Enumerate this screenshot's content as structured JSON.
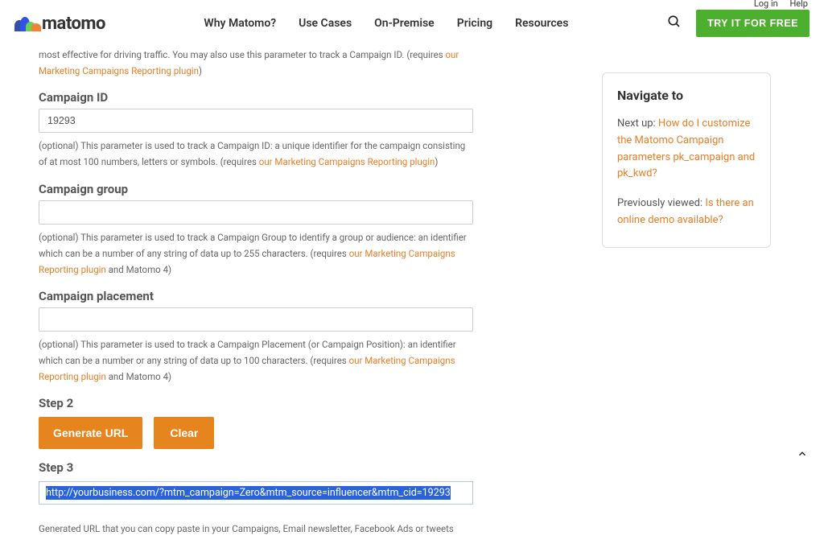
{
  "utilbar": {
    "login": "Log in",
    "help": "Help"
  },
  "brand": {
    "name": "matomo"
  },
  "nav": {
    "why": "Why Matomo?",
    "use_cases": "Use Cases",
    "on_premise": "On-Premise",
    "pricing": "Pricing",
    "resources": "Resources"
  },
  "cta_label": "TRY IT FOR FREE",
  "form": {
    "content_help_prefix": "most effective for driving traffic. You may also use this parameter to track a Campaign ID. (requires ",
    "content_help_link": "our Marketing Campaigns Reporting plugin",
    "content_help_suffix": ")",
    "campaign_id_label": "Campaign ID",
    "campaign_id_value": "19293",
    "campaign_id_help_prefix": "(optional) This parameter is used to track a Campaign ID: a unique identifier for the campaign consisting of at most 100 numbers, letters or symbols. (requires ",
    "campaign_id_help_link": "our Marketing Campaigns Reporting plugin",
    "campaign_id_help_suffix": ")",
    "campaign_group_label": "Campaign group",
    "campaign_group_value": "",
    "campaign_group_help_prefix": "(optional) This parameter is used to track a Campaign Group to identify a group or audience: an identifier which can be a number of any string of data up to 255 characters. (requires ",
    "campaign_group_help_link": "our Marketing Campaigns Reporting plugin",
    "campaign_group_help_suffix": " and Matomo 4)",
    "campaign_placement_label": "Campaign placement",
    "campaign_placement_value": "",
    "campaign_placement_help_prefix": "(optional) This parameter is used to track a Campaign Placement (or Campaign Position): an identifier which can be a number or any string of data up to 100 characters. (requires ",
    "campaign_placement_help_link": "our Marketing Campaigns Reporting plugin",
    "campaign_placement_help_suffix": " and Matomo 4)",
    "step2": "Step 2",
    "generate_label": "Generate URL",
    "clear_label": "Clear",
    "step3": "Step 3",
    "generated_url": "http://yourbusiness.com/?mtm_campaign=Zero&mtm_source=influencer&mtm_cid=19293",
    "generated_help": "Generated URL that you can copy paste in your Campaigns, Email newsletter, Facebook Ads or tweets"
  },
  "sidebar": {
    "title": "Navigate to",
    "next_label": "Next up: ",
    "next_link": "How do I customize the Matomo Campaign parameters pk_campaign and pk_kwd?",
    "prev_label": "Previously viewed: ",
    "prev_link": "Is there an online demo available?"
  }
}
